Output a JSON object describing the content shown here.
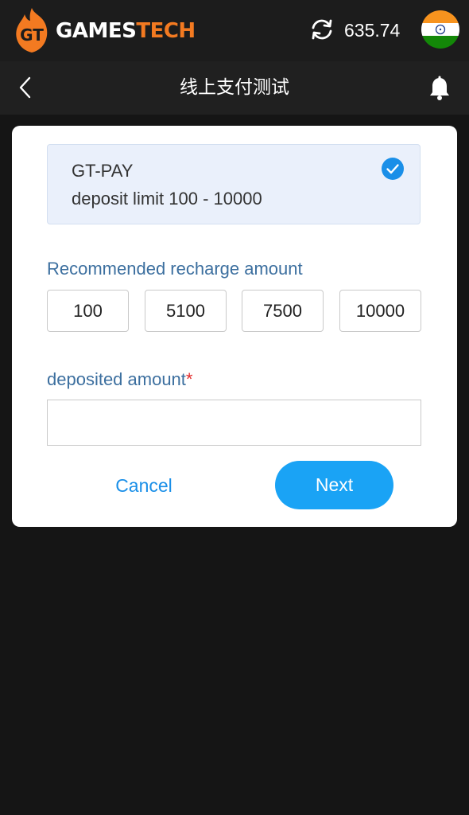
{
  "header": {
    "logo_text_light": "GAMES",
    "logo_text_accent": "TECH",
    "logo_mark_letters": "GT",
    "balance": "635.74",
    "refresh_icon": "refresh-icon",
    "flag_icon": "india-flag-icon"
  },
  "subheader": {
    "title": "线上支付测试",
    "back_icon": "chevron-left-icon",
    "bell_icon": "bell-icon"
  },
  "payment_method": {
    "name": "GT-PAY",
    "limit": "deposit limit 100 - 10000",
    "selected": true
  },
  "recommended": {
    "label": "Recommended recharge amount",
    "amounts": [
      "100",
      "5100",
      "7500",
      "10000"
    ]
  },
  "deposit": {
    "label": "deposited amount",
    "required_mark": "*",
    "value": ""
  },
  "actions": {
    "cancel_label": "Cancel",
    "next_label": "Next"
  },
  "colors": {
    "accent_orange": "#f37a21",
    "primary_blue": "#1aa3f5",
    "label_blue": "#3c6f9f",
    "required_red": "#e22b2b"
  }
}
